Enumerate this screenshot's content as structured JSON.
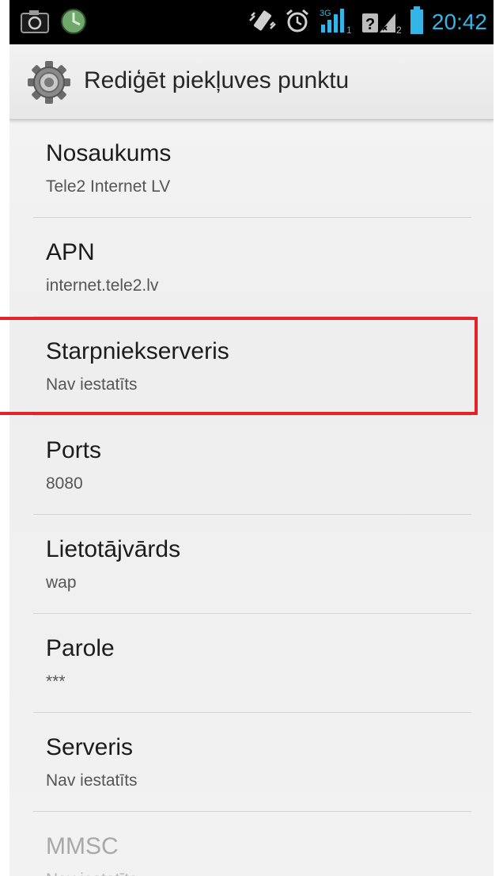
{
  "status_bar": {
    "time": "20:42",
    "icons": [
      "camera-icon",
      "circle-app-icon",
      "vibrate-icon",
      "alarm-icon",
      "signal-3g-sim1-icon",
      "signal-unknown-sim2-icon",
      "battery-icon"
    ],
    "sim1_label": "1",
    "sim2_label": "2",
    "network_label": "3G",
    "accent_color": "#33b5e5"
  },
  "action_bar": {
    "title": "Rediģēt piekļuves punktu",
    "icon": "settings-gear-icon"
  },
  "preferences": [
    {
      "title": "Nosaukums",
      "summary": "Tele2 Internet LV"
    },
    {
      "title": "APN",
      "summary": "internet.tele2.lv"
    },
    {
      "title": "Starpniekserveris",
      "summary": "Nav iestatīts"
    },
    {
      "title": "Ports",
      "summary": "8080"
    },
    {
      "title": "Lietotājvārds",
      "summary": "wap"
    },
    {
      "title": "Parole",
      "summary": "***"
    },
    {
      "title": "Serveris",
      "summary": "Nav iestatīts"
    },
    {
      "title": "MMSC",
      "summary": "Nav iestatīts"
    }
  ],
  "highlight_color": "#e2232a"
}
